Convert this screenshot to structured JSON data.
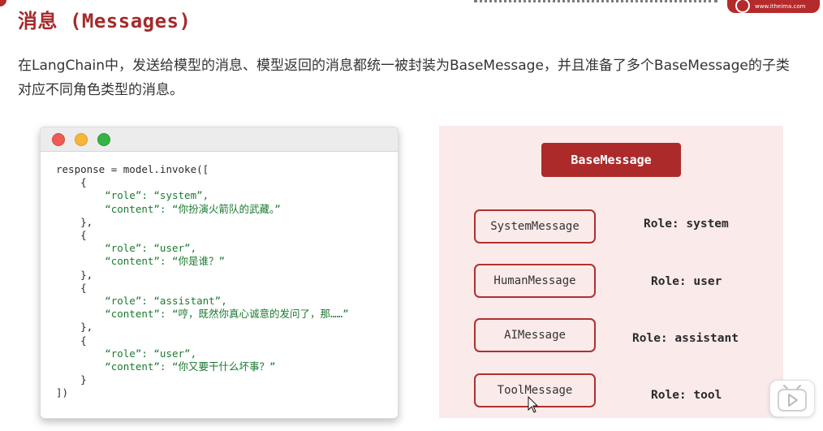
{
  "header": {
    "title": "消息 (Messages)"
  },
  "intro": {
    "text": "在LangChain中，发送给模型的消息、模型返回的消息都统一被封装为BaseMessage，并且准备了多个BaseMessage的子类对应不同角色类型的消息。"
  },
  "code_window": {
    "lines": [
      "response = model.invoke([",
      "    {",
      "        “role”: “system”,",
      "        “content”: “你扮演火箭队的武藏。”",
      "    },",
      "    {",
      "        “role”: “user”,",
      "        “content”: “你是谁？”",
      "    },",
      "    {",
      "        “role”: “assistant”,",
      "        “content”: “哼，既然你真心诚意的发问了，那……”",
      "    },",
      "    {",
      "        “role”: “user”,",
      "        “content”: “你又要干什么坏事？”",
      "    }",
      "])"
    ]
  },
  "diagram": {
    "base_label": "BaseMessage",
    "messages": [
      {
        "label": "SystemMessage",
        "role": "Role: system"
      },
      {
        "label": "HumanMessage",
        "role": "Role: user"
      },
      {
        "label": "AIMessage",
        "role": "Role: assistant"
      },
      {
        "label": "ToolMessage",
        "role": "Role: tool"
      }
    ]
  },
  "icons": {
    "window_buttons": [
      "close-dot",
      "minimize-dot",
      "maximize-dot"
    ],
    "cursor": "mouse-pointer-icon",
    "player": "play-icon"
  },
  "colors": {
    "accent": "#a52a2a",
    "diagram_bg": "#fbeaea",
    "code_string": "#1a7a2f"
  }
}
